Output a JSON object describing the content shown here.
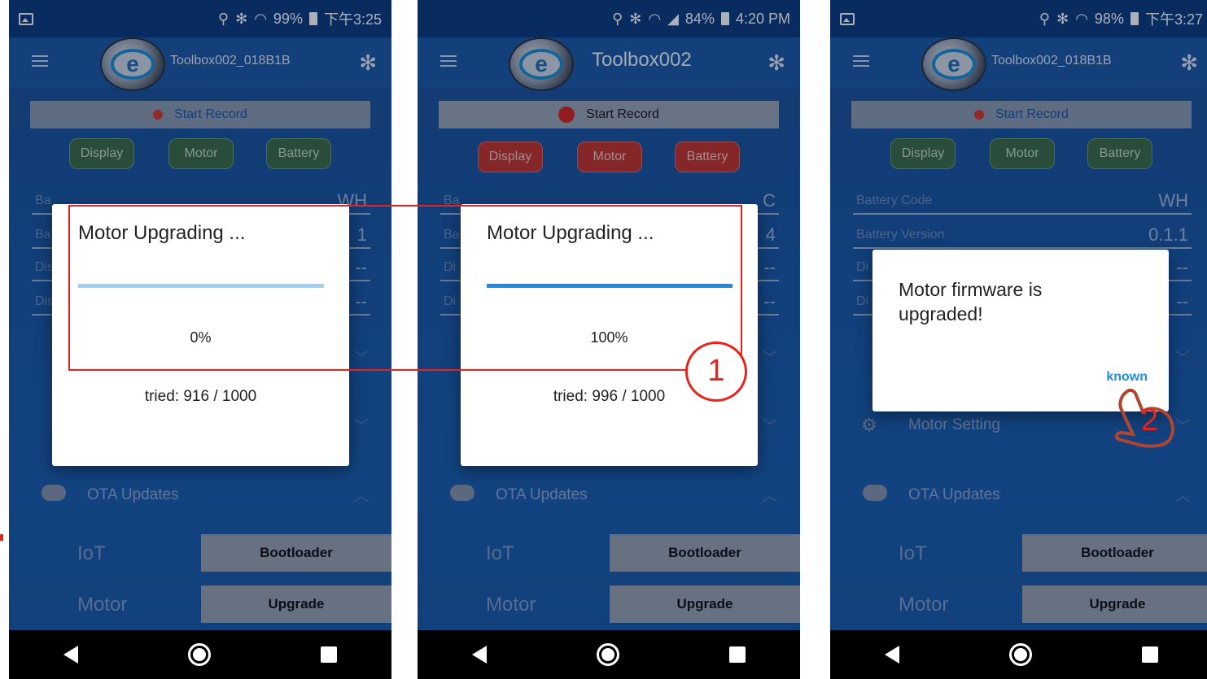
{
  "phones": [
    {
      "status": {
        "battery": "99%",
        "time": "下午3:25"
      },
      "device_name": "Toolbox002_018B1B",
      "record_label": "Start Record",
      "tabs": [
        "Display",
        "Motor",
        "Battery"
      ],
      "info_rows": [
        {
          "label": "Ba",
          "value": "WH"
        },
        {
          "label": "Ba",
          "value": "1"
        },
        {
          "label": "Dis",
          "value": "--"
        },
        {
          "label": "Dis",
          "value": "--"
        }
      ],
      "ota_label": "OTA Updates",
      "actions": [
        {
          "label": "IoT",
          "button": "Bootloader"
        },
        {
          "label": "Motor",
          "button": "Upgrade"
        }
      ],
      "dialog": {
        "title": "Motor Upgrading ...",
        "progress": 0.0,
        "percent_text": "0%",
        "tried_text": "tried: 916 / 1000"
      }
    },
    {
      "status": {
        "battery": "84%",
        "time": "4:20 PM"
      },
      "device_name": "Toolbox002",
      "record_label": "Start Record",
      "tabs": [
        "Display",
        "Motor",
        "Battery"
      ],
      "info_rows": [
        {
          "label": "Ba",
          "value": "C"
        },
        {
          "label": "Ba",
          "value": "4"
        },
        {
          "label": "Di",
          "value": "--"
        },
        {
          "label": "Di",
          "value": "--"
        }
      ],
      "ota_label": "OTA Updates",
      "actions": [
        {
          "label": "IoT",
          "button": "Bootloader"
        },
        {
          "label": "Motor",
          "button": "Upgrade"
        }
      ],
      "dialog": {
        "title": "Motor Upgrading ...",
        "progress": 1.0,
        "percent_text": "100%",
        "tried_text": "tried: 996 / 1000"
      }
    },
    {
      "status": {
        "battery": "98%",
        "time": "下午3:27"
      },
      "device_name": "Toolbox002_018B1B",
      "record_label": "Start Record",
      "tabs": [
        "Display",
        "Motor",
        "Battery"
      ],
      "info_rows": [
        {
          "label": "Battery Code",
          "value": "WH"
        },
        {
          "label": "Battery Version",
          "value": "0.1.1"
        },
        {
          "label": "Di",
          "value": "--"
        },
        {
          "label": "Di",
          "value": "--"
        }
      ],
      "motor_setting_label": "Motor Setting",
      "ota_label": "OTA Updates",
      "actions": [
        {
          "label": "IoT",
          "button": "Bootloader"
        },
        {
          "label": "Motor",
          "button": "Upgrade"
        }
      ],
      "dialog": {
        "title": "Motor firmware is upgraded!",
        "button": "known"
      }
    }
  ],
  "annotations": {
    "step1": "1",
    "step2": "2"
  },
  "colors": {
    "annotation": "#e8231c",
    "progress": "#1f8ae6",
    "record_dot": "#d63a2e",
    "tab_green": "#3d6e48",
    "tab_red": "#c5342e"
  }
}
